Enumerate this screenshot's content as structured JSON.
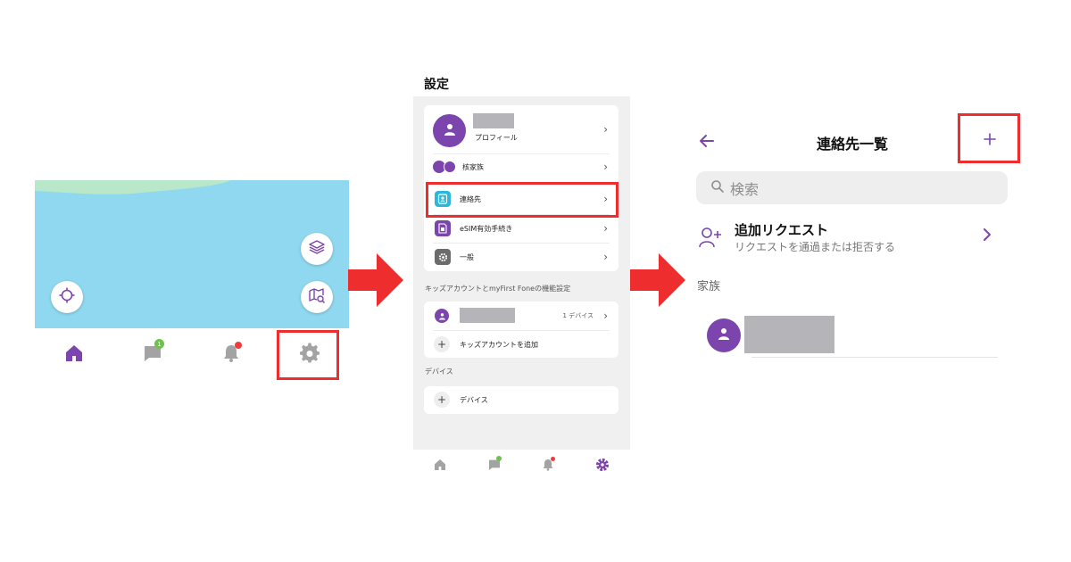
{
  "home": {
    "chat_badge": "1"
  },
  "settings": {
    "title": "設定",
    "profile_label": "プロフィール",
    "rows": [
      {
        "label": "核家族"
      },
      {
        "label": "連絡先"
      },
      {
        "label": "eSIM有効手続き"
      },
      {
        "label": "一般"
      }
    ],
    "kids_section_title": "キッズアカウントとmyFirst Foneの機能設定",
    "kid_device_count": "1 デバイス",
    "add_kid_label": "キッズアカウントを追加",
    "device_section_title": "デバイス",
    "device_label": "デバイス"
  },
  "contacts": {
    "title": "連絡先一覧",
    "search_placeholder": "検索",
    "add_request_title": "追加リクエスト",
    "add_request_subtitle": "リクエストを通過または拒否する",
    "family_section": "家族"
  },
  "colors": {
    "brand_purple": "#7b45ad",
    "highlight_red": "#ee2e2e",
    "map_water": "#8fd8ef",
    "map_land": "#b8e8c9"
  }
}
